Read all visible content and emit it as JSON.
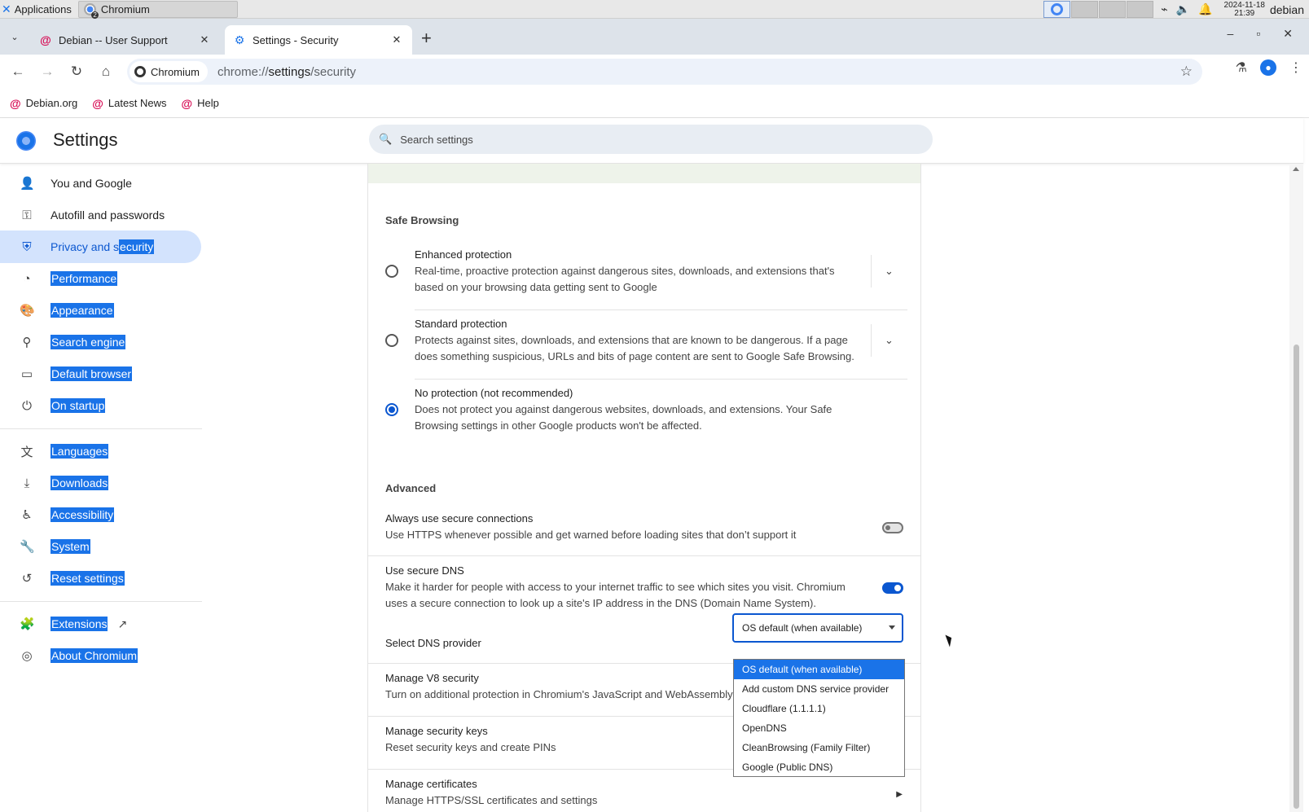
{
  "os": {
    "apps_label": "Applications",
    "task_label": "Chromium",
    "task_badge": "2",
    "clock_date": "2024-11-18",
    "clock_time": "21:39",
    "user": "debian"
  },
  "tabs": [
    {
      "title": "Debian -- User Support",
      "icon": "debian-swirl-icon"
    },
    {
      "title": "Settings - Security",
      "icon": "gear-icon"
    }
  ],
  "toolbar": {
    "chip_label": "Chromium",
    "url_prefix": "chrome://",
    "url_host": "settings",
    "url_path": "/security"
  },
  "bookmarks": [
    {
      "label": "Debian.org"
    },
    {
      "label": "Latest News"
    },
    {
      "label": "Help"
    }
  ],
  "settings": {
    "title": "Settings",
    "search_placeholder": "Search settings"
  },
  "sidebar": {
    "items": [
      {
        "label": "You and Google",
        "icon": "person-icon"
      },
      {
        "label": "Autofill and passwords",
        "icon": "key-icon"
      },
      {
        "label_plain": "Privacy and s",
        "label_sel": "ecurity",
        "icon": "shield-icon"
      },
      {
        "label": "Performance",
        "icon": "speedometer-icon"
      },
      {
        "label": "Appearance",
        "icon": "palette-icon"
      },
      {
        "label": "Search engine",
        "icon": "search-icon"
      },
      {
        "label": "Default browser",
        "icon": "browser-window-icon"
      },
      {
        "label": "On startup",
        "icon": "power-icon"
      },
      {
        "label": "Languages",
        "icon": "translate-icon"
      },
      {
        "label": "Downloads",
        "icon": "download-icon"
      },
      {
        "label": "Accessibility",
        "icon": "accessibility-icon"
      },
      {
        "label": "System",
        "icon": "wrench-icon"
      },
      {
        "label": "Reset settings",
        "icon": "reset-icon"
      },
      {
        "label": "Extensions",
        "icon": "puzzle-icon"
      },
      {
        "label": "About Chromium",
        "icon": "chromium-icon"
      }
    ]
  },
  "safe_browsing": {
    "title": "Safe Browsing",
    "options": [
      {
        "label": "Enhanced protection",
        "desc": "Real-time, proactive protection against dangerous sites, downloads, and extensions that's based on your browsing data getting sent to Google",
        "selected": false
      },
      {
        "label": "Standard protection",
        "desc": "Protects against sites, downloads, and extensions that are known to be dangerous. If a page does something suspicious, URLs and bits of page content are sent to Google Safe Browsing.",
        "selected": false
      },
      {
        "label": "No protection (not recommended)",
        "desc": "Does not protect you against dangerous websites, downloads, and extensions. Your Safe Browsing settings in other Google products won't be affected.",
        "selected": true
      }
    ]
  },
  "advanced": {
    "title": "Advanced",
    "https": {
      "label": "Always use secure connections",
      "desc": "Use HTTPS whenever possible and get warned before loading sites that don’t support it",
      "on": false
    },
    "dns": {
      "label": "Use secure DNS",
      "desc": "Make it harder for people with access to your internet traffic to see which sites you visit. Chromium uses a secure connection to look up a site's IP address in the DNS (Domain Name System).",
      "on": true
    },
    "dns_provider_label": "Select DNS provider",
    "dns_selected": "OS default (when available)",
    "dns_options": [
      "OS default (when available)",
      "Add custom DNS service provider",
      "Cloudflare (1.1.1.1)",
      "OpenDNS",
      "CleanBrowsing (Family Filter)",
      "Google (Public DNS)"
    ],
    "v8": {
      "label": "Manage V8 security",
      "desc": "Turn on additional protection in Chromium's JavaScript and WebAssembly"
    },
    "keys": {
      "label": "Manage security keys",
      "desc": "Reset security keys and create PINs"
    },
    "certs": {
      "label": "Manage certificates",
      "desc": "Manage HTTPS/SSL certificates and settings"
    }
  },
  "colors": {
    "accent": "#0b57d0",
    "selection": "#1a73e8",
    "nav_active_bg": "#d3e3fd"
  }
}
